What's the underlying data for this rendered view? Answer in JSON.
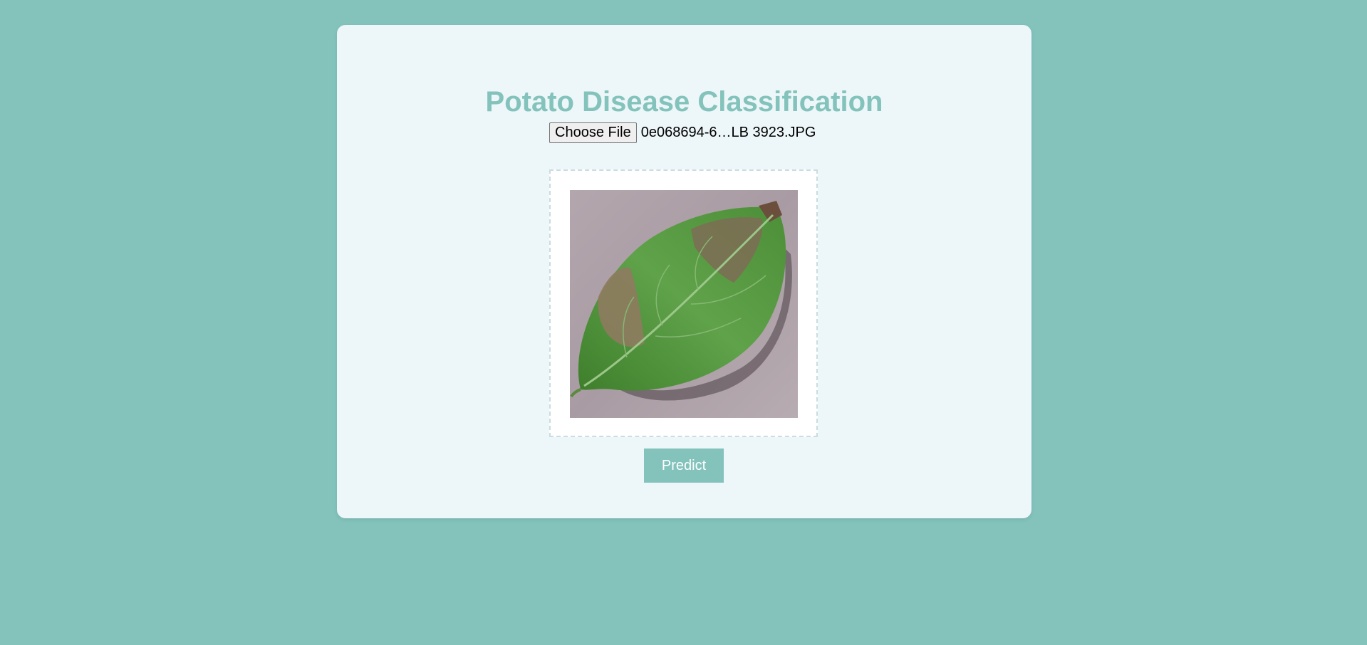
{
  "page": {
    "title": "Potato Disease Classification"
  },
  "upload": {
    "button_label": "Choose File",
    "file_name": "0e068694-6…LB 3923.JPG"
  },
  "preview": {
    "image_alt": "Uploaded potato leaf image"
  },
  "actions": {
    "predict_label": "Predict"
  },
  "colors": {
    "background": "#83c3bc",
    "card": "#edf6f8",
    "accent": "#83c3bc"
  }
}
